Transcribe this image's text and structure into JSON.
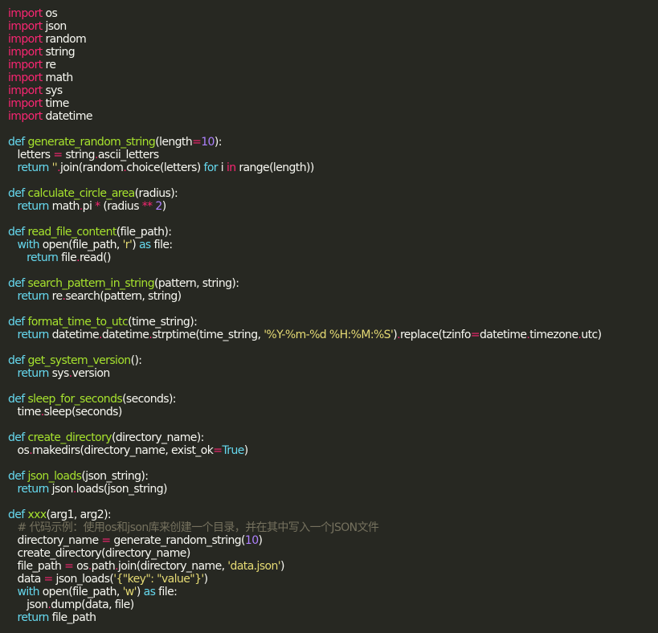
{
  "editor": {
    "background": "#272822",
    "colors": {
      "keyword": "#f92672",
      "def": "#66d9ef",
      "function": "#a6e22e",
      "string": "#e6db74",
      "number": "#ae81ff",
      "comment": "#75715e",
      "text": "#f8f8f2"
    },
    "lines": [
      [
        [
          "kw",
          "import"
        ],
        [
          "text",
          " os"
        ]
      ],
      [
        [
          "kw",
          "import"
        ],
        [
          "text",
          " json"
        ]
      ],
      [
        [
          "kw",
          "import"
        ],
        [
          "text",
          " random"
        ]
      ],
      [
        [
          "kw",
          "import"
        ],
        [
          "text",
          " string"
        ]
      ],
      [
        [
          "kw",
          "import"
        ],
        [
          "text",
          " re"
        ]
      ],
      [
        [
          "kw",
          "import"
        ],
        [
          "text",
          " math"
        ]
      ],
      [
        [
          "kw",
          "import"
        ],
        [
          "text",
          " sys"
        ]
      ],
      [
        [
          "kw",
          "import"
        ],
        [
          "text",
          " time"
        ]
      ],
      [
        [
          "kw",
          "import"
        ],
        [
          "text",
          " datetime"
        ]
      ],
      [],
      [
        [
          "def",
          "def "
        ],
        [
          "fn",
          "generate_random_string"
        ],
        [
          "text",
          "(length"
        ],
        [
          "op",
          "="
        ],
        [
          "num",
          "10"
        ],
        [
          "text",
          "):"
        ]
      ],
      [
        [
          "text",
          "   letters "
        ],
        [
          "op",
          "="
        ],
        [
          "text",
          " string"
        ],
        [
          "op",
          "."
        ],
        [
          "text",
          "ascii_letters"
        ]
      ],
      [
        [
          "def",
          "   return "
        ],
        [
          "str",
          "''"
        ],
        [
          "op",
          "."
        ],
        [
          "text",
          "join(random"
        ],
        [
          "op",
          "."
        ],
        [
          "text",
          "choice(letters) "
        ],
        [
          "def",
          "for"
        ],
        [
          "text",
          " i "
        ],
        [
          "kw",
          "in"
        ],
        [
          "text",
          " range(length))"
        ]
      ],
      [],
      [
        [
          "def",
          "def "
        ],
        [
          "fn",
          "calculate_circle_area"
        ],
        [
          "text",
          "(radius):"
        ]
      ],
      [
        [
          "def",
          "   return "
        ],
        [
          "text",
          "math"
        ],
        [
          "op",
          "."
        ],
        [
          "text",
          "pi "
        ],
        [
          "op",
          "*"
        ],
        [
          "text",
          " (radius "
        ],
        [
          "op",
          "**"
        ],
        [
          "text",
          " "
        ],
        [
          "num",
          "2"
        ],
        [
          "text",
          ")"
        ]
      ],
      [],
      [
        [
          "def",
          "def "
        ],
        [
          "fn",
          "read_file_content"
        ],
        [
          "text",
          "(file_path):"
        ]
      ],
      [
        [
          "def",
          "   with "
        ],
        [
          "text",
          "open(file_path, "
        ],
        [
          "str",
          "'r'"
        ],
        [
          "text",
          ") "
        ],
        [
          "def",
          "as"
        ],
        [
          "text",
          " file:"
        ]
      ],
      [
        [
          "def",
          "      return "
        ],
        [
          "text",
          "file"
        ],
        [
          "op",
          "."
        ],
        [
          "text",
          "read()"
        ]
      ],
      [],
      [
        [
          "def",
          "def "
        ],
        [
          "fn",
          "search_pattern_in_string"
        ],
        [
          "text",
          "(pattern, string):"
        ]
      ],
      [
        [
          "def",
          "   return "
        ],
        [
          "text",
          "re"
        ],
        [
          "op",
          "."
        ],
        [
          "text",
          "search(pattern, string)"
        ]
      ],
      [],
      [
        [
          "def",
          "def "
        ],
        [
          "fn",
          "format_time_to_utc"
        ],
        [
          "text",
          "(time_string):"
        ]
      ],
      [
        [
          "def",
          "   return "
        ],
        [
          "text",
          "datetime"
        ],
        [
          "op",
          "."
        ],
        [
          "text",
          "datetime"
        ],
        [
          "op",
          "."
        ],
        [
          "text",
          "strptime(time_string, "
        ],
        [
          "str",
          "'%Y-%m-%d %H:%M:%S'"
        ],
        [
          "text",
          ")"
        ],
        [
          "op",
          "."
        ],
        [
          "text",
          "replace(tzinfo"
        ],
        [
          "op",
          "="
        ],
        [
          "text",
          "datetime"
        ],
        [
          "op",
          "."
        ],
        [
          "text",
          "timezone"
        ],
        [
          "op",
          "."
        ],
        [
          "text",
          "utc)"
        ]
      ],
      [],
      [
        [
          "def",
          "def "
        ],
        [
          "fn",
          "get_system_version"
        ],
        [
          "text",
          "():"
        ]
      ],
      [
        [
          "def",
          "   return "
        ],
        [
          "text",
          "sys"
        ],
        [
          "op",
          "."
        ],
        [
          "text",
          "version"
        ]
      ],
      [],
      [
        [
          "def",
          "def "
        ],
        [
          "fn",
          "sleep_for_seconds"
        ],
        [
          "text",
          "(seconds):"
        ]
      ],
      [
        [
          "text",
          "   time"
        ],
        [
          "op",
          "."
        ],
        [
          "text",
          "sleep(seconds)"
        ]
      ],
      [],
      [
        [
          "def",
          "def "
        ],
        [
          "fn",
          "create_directory"
        ],
        [
          "text",
          "(directory_name):"
        ]
      ],
      [
        [
          "text",
          "   os"
        ],
        [
          "op",
          "."
        ],
        [
          "text",
          "makedirs(directory_name, exist_ok"
        ],
        [
          "op",
          "="
        ],
        [
          "const",
          "True"
        ],
        [
          "text",
          ")"
        ]
      ],
      [],
      [
        [
          "def",
          "def "
        ],
        [
          "fn",
          "json_loads"
        ],
        [
          "text",
          "(json_string):"
        ]
      ],
      [
        [
          "def",
          "   return "
        ],
        [
          "text",
          "json"
        ],
        [
          "op",
          "."
        ],
        [
          "text",
          "loads(json_string)"
        ]
      ],
      [],
      [
        [
          "def",
          "def "
        ],
        [
          "fn",
          "xxx"
        ],
        [
          "text",
          "(arg1, arg2):"
        ]
      ],
      [
        [
          "com",
          "   # 代码示例：使用os和json库来创建一个目录，并在其中写入一个JSON文件"
        ]
      ],
      [
        [
          "text",
          "   directory_name "
        ],
        [
          "op",
          "="
        ],
        [
          "text",
          " generate_random_string("
        ],
        [
          "num",
          "10"
        ],
        [
          "text",
          ")"
        ]
      ],
      [
        [
          "text",
          "   create_directory(directory_name)"
        ]
      ],
      [
        [
          "text",
          "   file_path "
        ],
        [
          "op",
          "="
        ],
        [
          "text",
          " os"
        ],
        [
          "op",
          "."
        ],
        [
          "text",
          "path"
        ],
        [
          "op",
          "."
        ],
        [
          "text",
          "join(directory_name, "
        ],
        [
          "str",
          "'data.json'"
        ],
        [
          "text",
          ")"
        ]
      ],
      [
        [
          "text",
          "   data "
        ],
        [
          "op",
          "="
        ],
        [
          "text",
          " json_loads("
        ],
        [
          "str",
          "'{\"key\": \"value\"}'"
        ],
        [
          "text",
          ")"
        ]
      ],
      [
        [
          "def",
          "   with "
        ],
        [
          "text",
          "open(file_path, "
        ],
        [
          "str",
          "'w'"
        ],
        [
          "text",
          ") "
        ],
        [
          "def",
          "as"
        ],
        [
          "text",
          " file:"
        ]
      ],
      [
        [
          "text",
          "      json"
        ],
        [
          "op",
          "."
        ],
        [
          "text",
          "dump(data, file)"
        ]
      ],
      [
        [
          "def",
          "   return "
        ],
        [
          "text",
          "file_path"
        ]
      ]
    ]
  }
}
